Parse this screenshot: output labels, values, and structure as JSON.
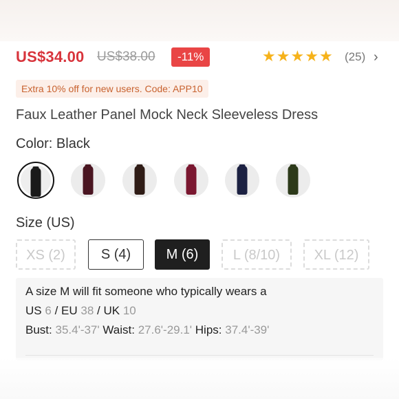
{
  "price": {
    "current": "US$34.00",
    "original": "US$38.00",
    "discount": "-11%"
  },
  "rating": {
    "stars": 5,
    "count": "(25)"
  },
  "promo": "Extra 10% off for new users. Code: APP10",
  "product_title": "Faux Leather Panel Mock Neck Sleeveless Dress",
  "color": {
    "label": "Color: Black",
    "options": [
      {
        "name": "black",
        "hex": "#1a1a1a",
        "selected": true
      },
      {
        "name": "burgundy",
        "hex": "#4a1622"
      },
      {
        "name": "brown",
        "hex": "#2f1c16"
      },
      {
        "name": "wine-red",
        "hex": "#7a1730"
      },
      {
        "name": "navy",
        "hex": "#1c2142"
      },
      {
        "name": "olive",
        "hex": "#2d3a1a"
      }
    ]
  },
  "size": {
    "label": "Size (US)",
    "options": [
      {
        "label": "XS (2)",
        "state": "disabled"
      },
      {
        "label": "S (4)",
        "state": "available"
      },
      {
        "label": "M (6)",
        "state": "selected"
      },
      {
        "label": "L (8/10)",
        "state": "disabled"
      },
      {
        "label": "XL (12)",
        "state": "disabled"
      }
    ]
  },
  "fit": {
    "intro": "A size M will fit someone who typically wears a",
    "us_label": "US",
    "us_value": "6",
    "eu_label": "/ EU",
    "eu_value": "38",
    "uk_label": "/ UK",
    "uk_value": "10",
    "bust_label": "Bust:",
    "bust_value": "35.4'-37'",
    "waist_label": "Waist:",
    "waist_value": "27.6'-29.1'",
    "hips_label": "Hips:",
    "hips_value": "37.4'-39'"
  }
}
